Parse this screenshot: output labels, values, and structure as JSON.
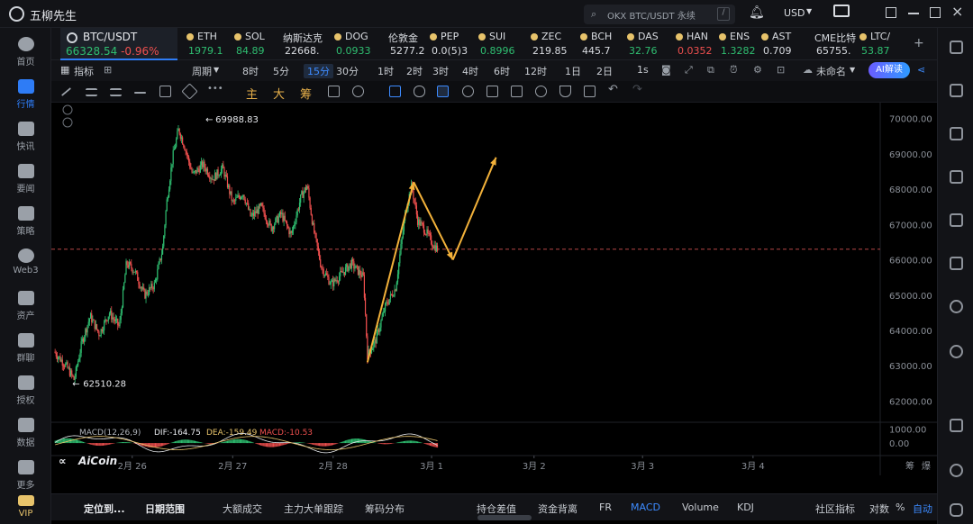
{
  "app": {
    "title": "五柳先生",
    "logo": "柳"
  },
  "search": {
    "text": "OKX BTC/USDT 永续",
    "slash": "/"
  },
  "window": {
    "currency": "USD"
  },
  "sidebar": {
    "items": [
      {
        "label": "首页",
        "icon": "home-icon"
      },
      {
        "label": "行情",
        "icon": "chart-bars-icon"
      },
      {
        "label": "快讯",
        "icon": "news-icon"
      },
      {
        "label": "要闻",
        "icon": "document-icon"
      },
      {
        "label": "策略",
        "icon": "robot-icon"
      },
      {
        "label": "Web3",
        "icon": "web3-icon"
      },
      {
        "label": "资产",
        "icon": "wallet-icon"
      },
      {
        "label": "群聊",
        "icon": "chat-icon"
      },
      {
        "label": "授权",
        "icon": "key-icon"
      },
      {
        "label": "数据",
        "icon": "data-icon"
      },
      {
        "label": "更多",
        "icon": "grid-icon"
      },
      {
        "label": "VIP",
        "icon": "crown-icon"
      }
    ]
  },
  "tickers": {
    "active": {
      "name": "BTC/USDT",
      "price": "66328.54",
      "change": "-0.96%"
    },
    "items": [
      {
        "name": "ETH",
        "price": "1979.1",
        "trend": "up"
      },
      {
        "name": "SOL",
        "price": "84.89",
        "trend": "up"
      },
      {
        "name": "纳斯达克",
        "price": "22668.",
        "trend": "neutral"
      },
      {
        "name": "DOG",
        "price": "0.0933",
        "trend": "up"
      },
      {
        "name": "伦敦金",
        "price": "5277.2",
        "trend": "neutral"
      },
      {
        "name": "PEP",
        "price": "0.0(5)3",
        "trend": "neutral"
      },
      {
        "name": "SUI",
        "price": "0.8996",
        "trend": "up"
      },
      {
        "name": "ZEC",
        "price": "219.85",
        "trend": "neutral"
      },
      {
        "name": "BCH",
        "price": "445.7",
        "trend": "neutral"
      },
      {
        "name": "DAS",
        "price": "32.76",
        "trend": "up"
      },
      {
        "name": "HAN",
        "price": "0.0352",
        "trend": "down"
      },
      {
        "name": "ENS",
        "price": "1.3282",
        "trend": "up"
      },
      {
        "name": "AST",
        "price": "0.709",
        "trend": "neutral"
      },
      {
        "name": "CME比特",
        "price": "65755.",
        "trend": "neutral"
      },
      {
        "name": "LTC/",
        "price": "53.87",
        "trend": "up"
      }
    ],
    "add": "+"
  },
  "toolbar": {
    "indicator": "指标",
    "period": "周期",
    "intervals": [
      "8时",
      "5分",
      "15分",
      "30分",
      "1时",
      "2时",
      "3时",
      "4时",
      "6时",
      "12时",
      "1日",
      "2日"
    ],
    "selected_interval": "15分",
    "realtime": "1s",
    "layout_name": "未命名",
    "ai_button": "AI解读"
  },
  "drawbar": {
    "main": "主",
    "big": "大",
    "chips": "筹"
  },
  "chart_data": {
    "type": "candlestick",
    "title": "",
    "x_ticks": [
      "2月 26",
      "2月 27",
      "2月 28",
      "3月 1",
      "3月 2",
      "3月 3",
      "3月 4"
    ],
    "y_ticks": [
      "70000.00",
      "69000.00",
      "68000.00",
      "67000.00",
      "66000.00",
      "65000.00",
      "64000.00",
      "63000.00",
      "62000.00"
    ],
    "ylim": [
      61400,
      70450
    ],
    "high_label": "69988.83",
    "low_label": "62510.28",
    "current_price_line": 66300,
    "price_path": [
      [
        0,
        63400
      ],
      [
        0.12,
        63000
      ],
      [
        0.2,
        62600
      ],
      [
        0.28,
        63700
      ],
      [
        0.36,
        64400
      ],
      [
        0.45,
        63900
      ],
      [
        0.55,
        64500
      ],
      [
        0.65,
        64100
      ],
      [
        0.72,
        65900
      ],
      [
        0.8,
        65700
      ],
      [
        0.9,
        65000
      ],
      [
        1.0,
        65300
      ],
      [
        1.08,
        66300
      ],
      [
        1.12,
        67600
      ],
      [
        1.18,
        68900
      ],
      [
        1.24,
        69700
      ],
      [
        1.3,
        69200
      ],
      [
        1.38,
        68400
      ],
      [
        1.48,
        68700
      ],
      [
        1.58,
        68300
      ],
      [
        1.68,
        68600
      ],
      [
        1.78,
        67600
      ],
      [
        1.88,
        67900
      ],
      [
        1.96,
        67200
      ],
      [
        2.06,
        67500
      ],
      [
        2.16,
        66900
      ],
      [
        2.26,
        67300
      ],
      [
        2.36,
        66700
      ],
      [
        2.46,
        67800
      ],
      [
        2.52,
        68100
      ],
      [
        2.58,
        66900
      ],
      [
        2.66,
        65800
      ],
      [
        2.76,
        65300
      ],
      [
        2.86,
        65600
      ],
      [
        2.96,
        65900
      ],
      [
        3.08,
        65500
      ],
      [
        3.12,
        63300
      ],
      [
        3.2,
        63700
      ],
      [
        3.3,
        64700
      ],
      [
        3.4,
        65200
      ],
      [
        3.5,
        67400
      ],
      [
        3.56,
        68100
      ],
      [
        3.62,
        67100
      ],
      [
        3.68,
        66900
      ],
      [
        3.78,
        66400
      ],
      [
        3.82,
        66300
      ]
    ],
    "annotations": [
      {
        "type": "arrow",
        "from": [
          3.12,
          63100
        ],
        "to": [
          3.58,
          68200
        ]
      },
      {
        "type": "arrow",
        "from": [
          3.58,
          68200
        ],
        "to": [
          3.97,
          66000
        ]
      },
      {
        "type": "arrow",
        "from": [
          3.97,
          66000
        ],
        "to": [
          4.4,
          68900
        ]
      }
    ],
    "macd": {
      "label": "MACD(12,26,9)",
      "dif": "DIF:-164.75",
      "dea": "DEA:-159.49",
      "macd": "MACD:-10.53",
      "y_ticks": [
        "1000.00",
        "0.00"
      ]
    },
    "watermark": "AiCoin"
  },
  "right_axis_extra": [
    "筹",
    "爆"
  ],
  "bottombar": {
    "items": [
      "定位到...",
      "日期范围",
      "大额成交",
      "主力大单跟踪",
      "筹码分布",
      "持仓差值",
      "资金背离",
      "FR",
      "MACD",
      "Volume",
      "KDJ",
      "社区指标",
      "对数",
      "%",
      "自动"
    ]
  }
}
